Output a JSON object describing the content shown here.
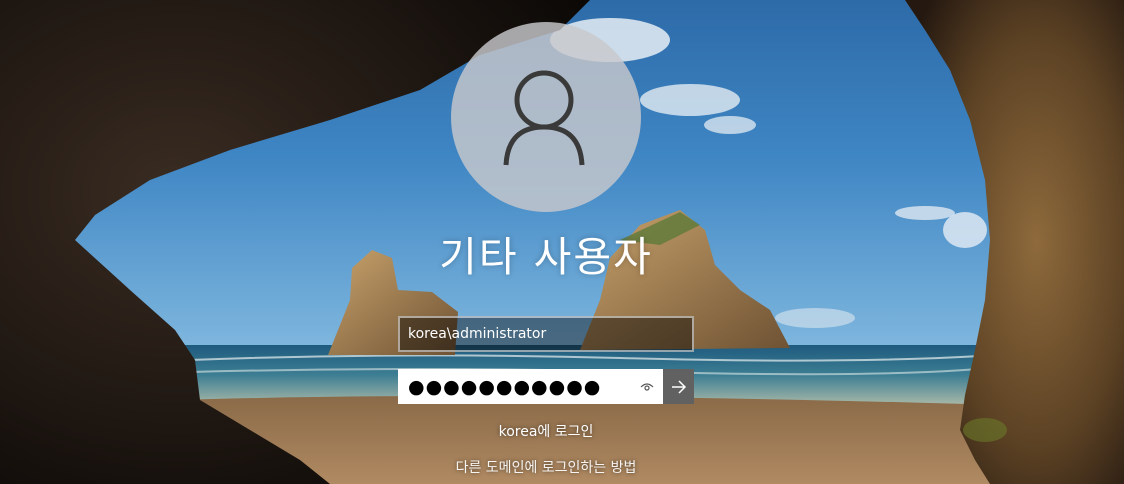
{
  "user": {
    "display_name": "기타 사용자"
  },
  "username_field": {
    "value": "korea\\administrator"
  },
  "password_field": {
    "masked_value": "●●●●●●●●●●●",
    "reveal_icon": "eye-icon",
    "submit_icon": "arrow-right-icon"
  },
  "sign_in_to": "korea에 로그인",
  "other_domain_link": "다른 도메인에 로그인하는 방법"
}
